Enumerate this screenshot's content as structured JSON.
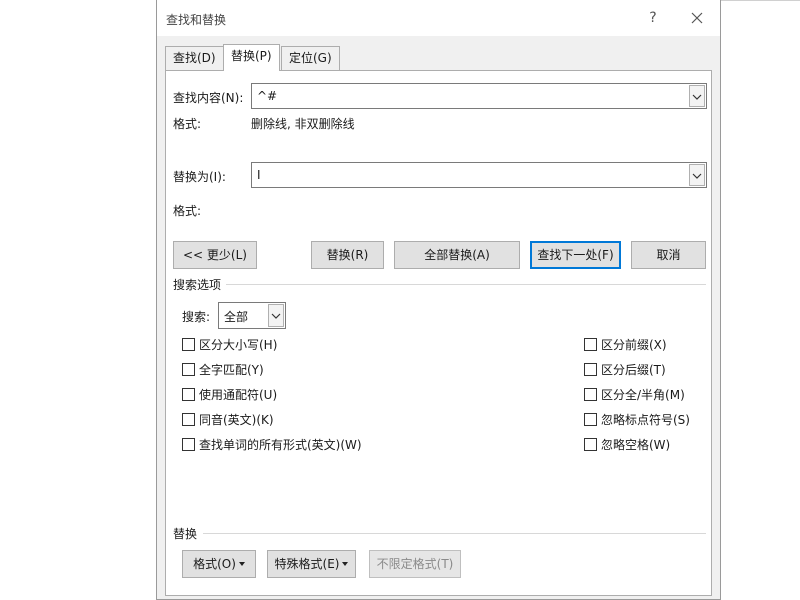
{
  "dialog": {
    "title": "查找和替换",
    "help": "?",
    "close": "✕"
  },
  "tabs": [
    {
      "label": "查找(D)"
    },
    {
      "label": "替换(P)"
    },
    {
      "label": "定位(G)"
    }
  ],
  "find": {
    "label": "查找内容(N):",
    "value": "^#",
    "format_label": "格式:",
    "format_value": "删除线, 非双删除线"
  },
  "replace": {
    "label": "替换为(I):",
    "value": "I",
    "format_label": "格式:"
  },
  "buttons": {
    "less": "<< 更少(L)",
    "replace": "替换(R)",
    "replace_all": "全部替换(A)",
    "find_next": "查找下一处(F)",
    "cancel": "取消"
  },
  "search_options": {
    "heading": "搜索选项",
    "search_label": "搜索:",
    "search_value": "全部"
  },
  "checkboxes_left": [
    {
      "label": "区分大小写(H)"
    },
    {
      "label": "全字匹配(Y)"
    },
    {
      "label": "使用通配符(U)"
    },
    {
      "label": "同音(英文)(K)"
    },
    {
      "label": "查找单词的所有形式(英文)(W)"
    }
  ],
  "checkboxes_right": [
    {
      "label": "区分前缀(X)"
    },
    {
      "label": "区分后缀(T)"
    },
    {
      "label": "区分全/半角(M)"
    },
    {
      "label": "忽略标点符号(S)"
    },
    {
      "label": "忽略空格(W)"
    }
  ],
  "replace_section": {
    "heading": "替换",
    "format_button": "格式(O)",
    "special_button": "特殊格式(E)",
    "no_format_button": "不限定格式(T)"
  }
}
